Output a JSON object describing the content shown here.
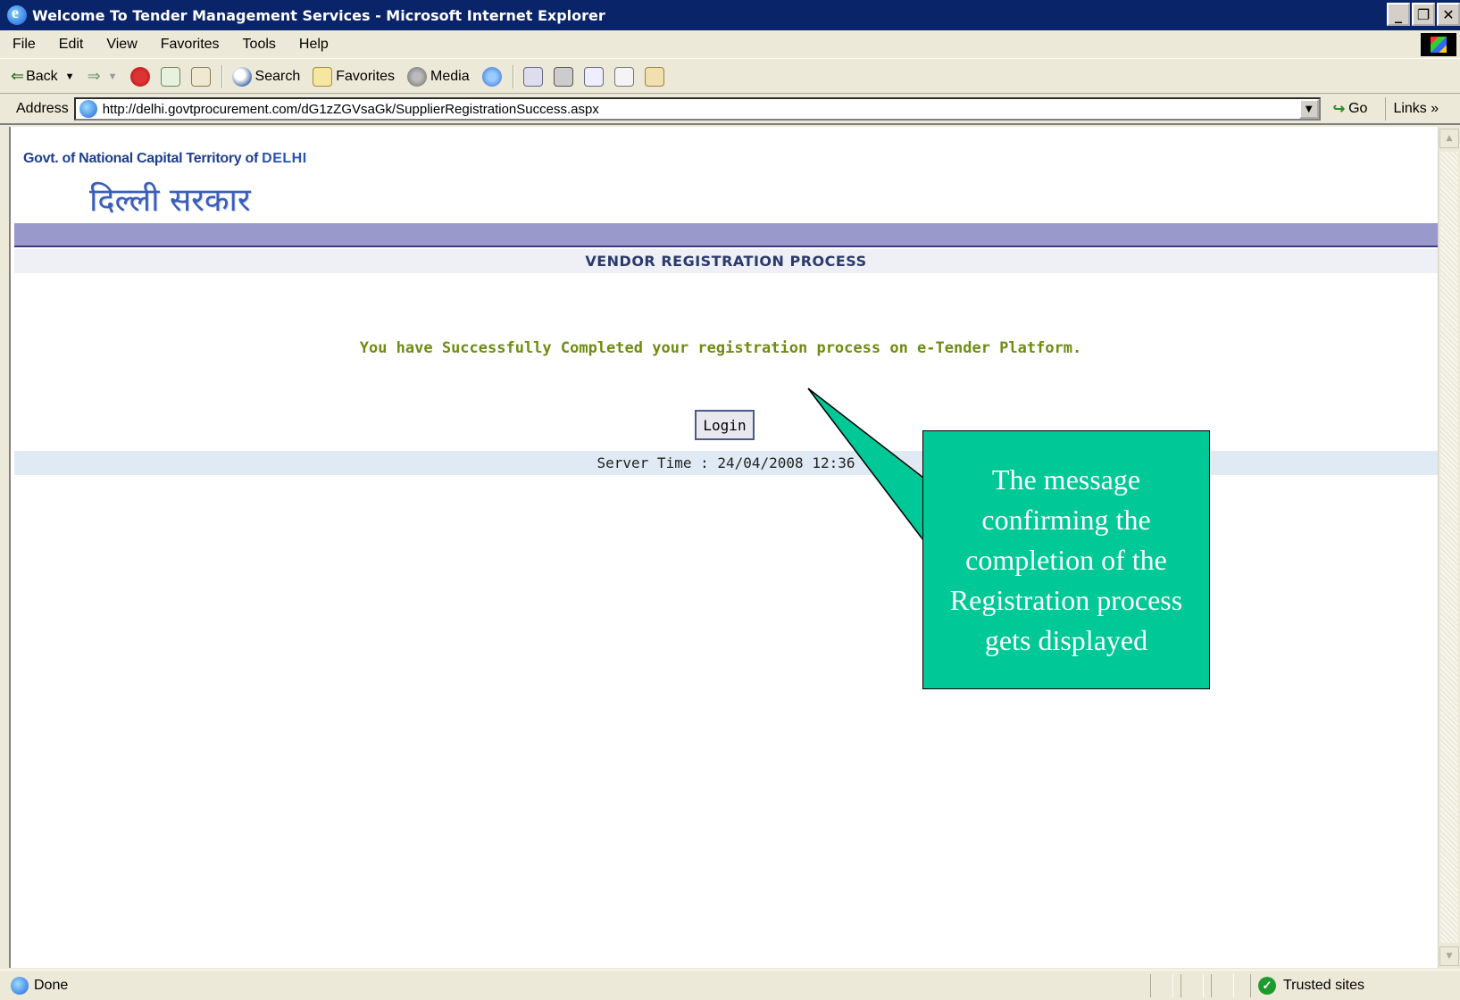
{
  "window": {
    "title": "Welcome To Tender Management Services - Microsoft Internet Explorer",
    "controls": {
      "minimize": "_",
      "maximize": "❐",
      "close": "✕"
    }
  },
  "menu": [
    "File",
    "Edit",
    "View",
    "Favorites",
    "Tools",
    "Help"
  ],
  "toolbar": {
    "back": "Back",
    "search": "Search",
    "favorites": "Favorites",
    "media": "Media"
  },
  "address": {
    "label": "Address",
    "url": "http://delhi.govtprocurement.com/dG1zZGVsaGk/SupplierRegistrationSuccess.aspx",
    "go": "Go",
    "links": "Links »"
  },
  "page": {
    "logo_prefix": "Govt. of National Capital Territory of ",
    "logo_delhi": "DELHI",
    "logo_hindi": "दिल्ली सरकार",
    "heading": "VENDOR REGISTRATION PROCESS",
    "success_message": "You have Successfully Completed your registration process on e-Tender Platform.",
    "login_label": "Login",
    "server_time": "Server Time : 24/04/2008 12:36"
  },
  "callout": {
    "text": "The message confirming the completion of the Registration process gets displayed",
    "color": "#00c896"
  },
  "status": {
    "text": "Done",
    "zone": "Trusted sites"
  },
  "colors": {
    "titlebar": "#0a246a",
    "band": "#9999cc",
    "success": "#6f8c12",
    "heading": "#2b3a6b"
  }
}
